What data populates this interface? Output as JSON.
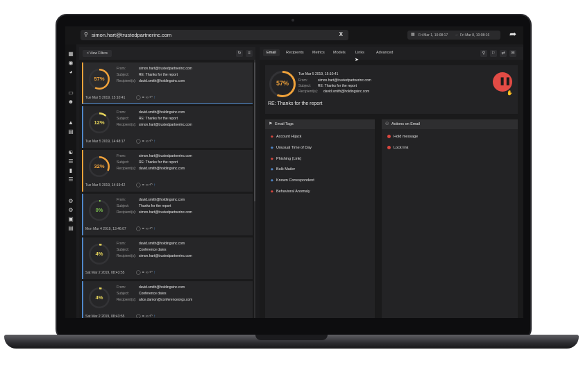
{
  "search": {
    "value": "simon.hart@trustedpartnerinc.com",
    "clear": "X"
  },
  "daterange": {
    "start": "Fri Mar 1, 10:08:17",
    "arrow": "→",
    "end": "Fri Mar 8, 10:08:16"
  },
  "list": {
    "view_filters": "< View Filters",
    "labels": {
      "from": "From:",
      "subject": "Subject:",
      "recipients": "Recipient(s):"
    },
    "items": [
      {
        "score": "57%",
        "score_value": 57,
        "color": "#f0a23a",
        "from": "simon.hart@trustedpartnerinc.com",
        "subject": "RE: Thanks for the report",
        "recipients": "david.smith@holdingsinc.com",
        "date": "Tue Mar 5 2019, 15:10:41"
      },
      {
        "score": "12%",
        "score_value": 12,
        "color": "#e5d35a",
        "from": "david.smith@holdingsinc.com",
        "subject": "RE: Thanks for the report",
        "recipients": "simon.hart@trustedpartnerinc.com",
        "date": "Tue Mar 5 2019, 14:48:17"
      },
      {
        "score": "32%",
        "score_value": 32,
        "color": "#f0a23a",
        "from": "simon.hart@trustedpartnerinc.com",
        "subject": "RE: Thanks for the report",
        "recipients": "david.smith@holdingsinc.com",
        "date": "Tue Mar 5 2019, 14:19:42"
      },
      {
        "score": "0%",
        "score_value": 0,
        "color": "#7dc24f",
        "from": "david.smith@holdingsinc.com",
        "subject": "Thanks for the report",
        "recipients": "simon.hart@trustedpartnerinc.com",
        "date": "Mon Mar 4 2019, 13:46:07"
      },
      {
        "score": "4%",
        "score_value": 4,
        "color": "#e5d35a",
        "from": "david.smith@holdingsinc.com",
        "subject": "Conference dates",
        "recipients": "simon.hart@trustedpartnerinc.com",
        "date": "Sat Mar 2 2019, 08:43:55"
      },
      {
        "score": "4%",
        "score_value": 4,
        "color": "#e5d35a",
        "from": "david.smith@holdingsinc.com",
        "subject": "Conference dates",
        "recipients": "alice.damon@conferenceorgs.com",
        "date": "Sat Mar 2 2019, 08:43:55"
      }
    ]
  },
  "tabs": [
    "Email",
    "Recipients",
    "Metrics",
    "Models",
    "Links",
    "Advanced"
  ],
  "summary": {
    "score": "57%",
    "score_value": 57,
    "date": "Tue Mar 5 2019, 15:10:41",
    "from": "simon.hart@trustedpartnerinc.com",
    "subject": "RE: Thanks for the report",
    "recipients": "david.smith@holdingsinc.com",
    "headline": "RE: Thanks for the report"
  },
  "email_tags": {
    "title": "Email Tags",
    "items": [
      {
        "label": "Account Hijack",
        "color": "#d9473f"
      },
      {
        "label": "Unusual Time of Day",
        "color": "#4f87c9"
      },
      {
        "label": "Phishing (Link)",
        "color": "#d9473f"
      },
      {
        "label": "Bulk Mailer",
        "color": "#4f87c9"
      },
      {
        "label": "Known Correspondent",
        "color": "#4f87c9"
      },
      {
        "label": "Behavioral Anomaly",
        "color": "#d9473f"
      }
    ]
  },
  "actions": {
    "title": "Actions on Email",
    "items": [
      {
        "label": "Hold message"
      },
      {
        "label": "Lock link"
      }
    ]
  },
  "colors": {
    "accent_orange": "#f0a23a",
    "accent_blue": "#4f87c9",
    "danger_red": "#e24b45",
    "yellow": "#e5d35a",
    "green": "#7dc24f"
  }
}
